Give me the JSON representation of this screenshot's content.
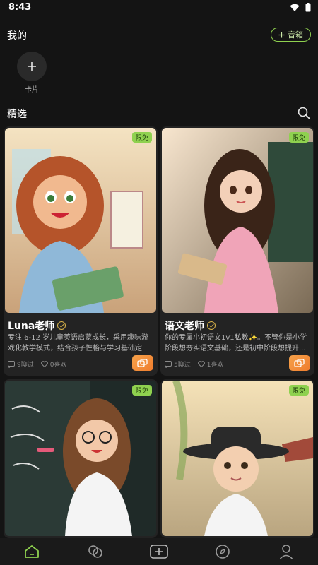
{
  "status": {
    "time": "8:43"
  },
  "mine": {
    "title": "我的",
    "music_box_label": "音箱",
    "add_card_label": "卡片"
  },
  "featured": {
    "title": "精选"
  },
  "cards": [
    {
      "title": "Luna老师",
      "badge": "限免",
      "description": "专注 6-12 岁儿童英语启蒙成长，采用趣味游戏化教学模式，结合孩子性格与学习基础定制...",
      "chats": "9聊过",
      "likes": "0喜欢"
    },
    {
      "title": "语文老师",
      "badge": "限免",
      "description": "你的专属小初语文1v1私教✨。不管你是小学阶段想夯实语文基础，还是初中阶段想提升...",
      "chats": "5聊过",
      "likes": "1喜欢"
    },
    {
      "badge": "限免"
    },
    {
      "badge": "限免"
    }
  ],
  "colors": {
    "accent": "#8fd14f",
    "chat_button": "#ef7c2d",
    "background": "#141414"
  }
}
